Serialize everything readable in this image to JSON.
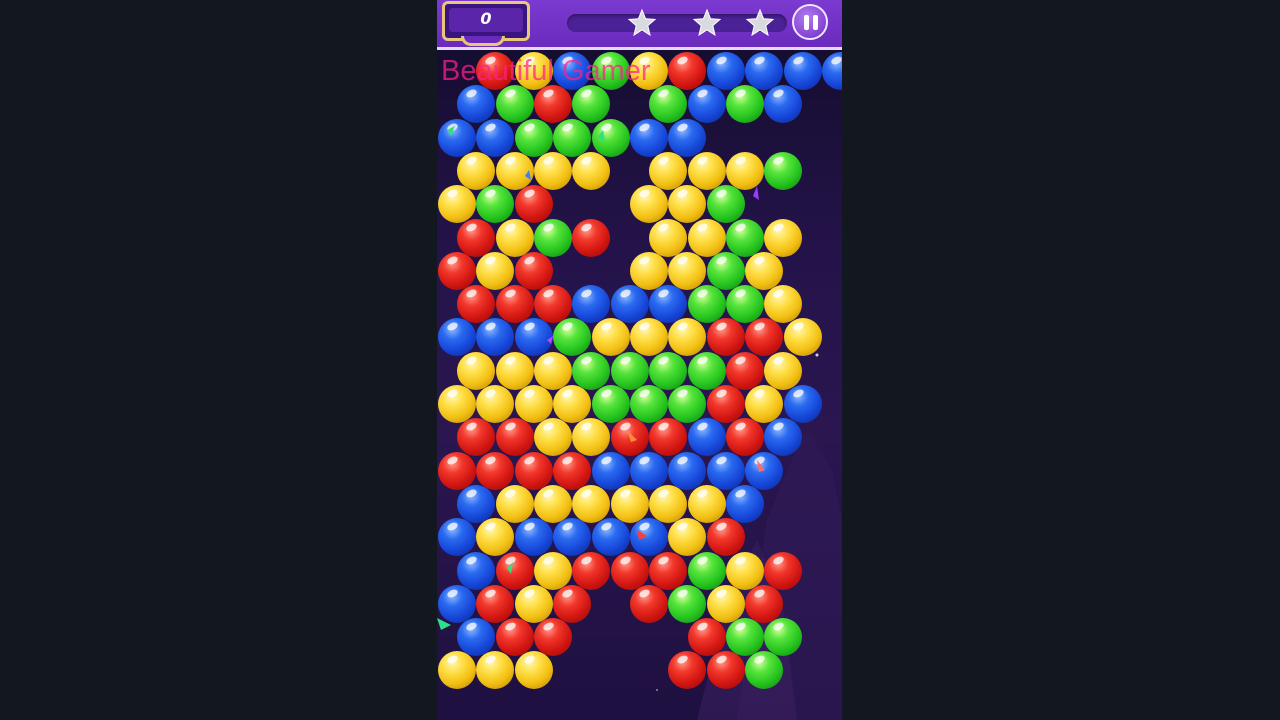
{
  "hud": {
    "score": "0",
    "progress": 0.0,
    "stars": [
      "empty",
      "empty",
      "empty"
    ],
    "star_icon": "star-icon",
    "pause_icon": "pause-icon"
  },
  "watermark": "Beautiful Gamer",
  "colors": {
    "R": "#d21612",
    "B": "#1646d8",
    "G": "#25c41e",
    "Y": "#f2bf12",
    "hud": "#6a2bbd",
    "score_frame": "#e9c77a",
    "watermark": "#ff1f8c"
  },
  "grid": [
    ".RYBGYRBBBBR",
    "BGRG.GBGB",
    "BBGGGBB",
    "YYYY.YYYG",
    "YGR..YYG",
    "RYGR.YYGY",
    "RYR..YYGY",
    "RRRBBBGGY",
    "BBBGYYYRRY",
    "YYYGGGGRY",
    "YYYYGGGRYB",
    "RRYYRRBRB",
    "RRRRBBBBB",
    "BYYYYYYB",
    "BYBBBBYR",
    "BRYRRRGYR",
    "BRYR.RGYR",
    "BRR...RGG",
    "YYY...RRG"
  ]
}
